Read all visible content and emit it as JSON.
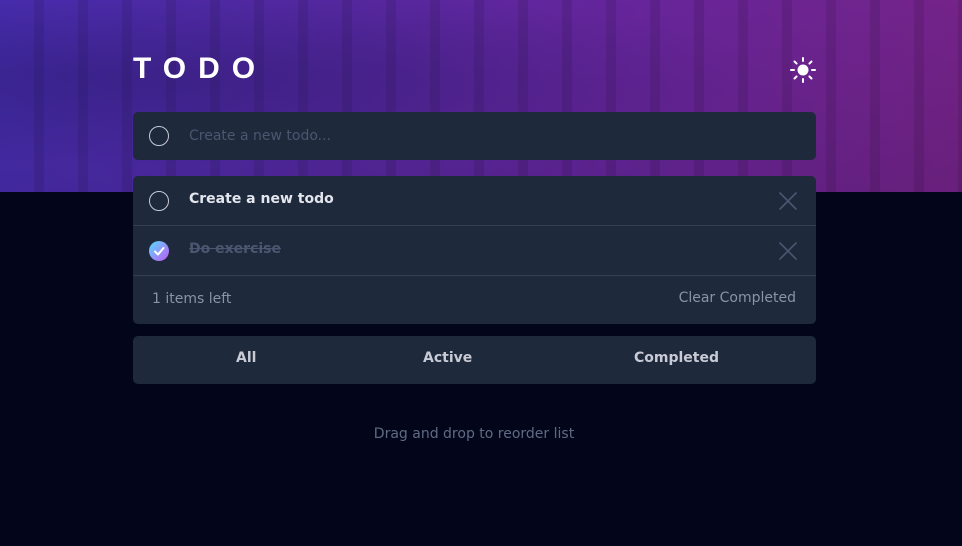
{
  "header": {
    "title": "TODO",
    "theme_icon": "sun-icon"
  },
  "new_todo": {
    "placeholder": "Create a new todo...",
    "value": ""
  },
  "todos": [
    {
      "label": "Create a new todo",
      "completed": false
    },
    {
      "label": "Do exercise",
      "completed": true
    }
  ],
  "footer": {
    "items_left": "1 items left",
    "clear_label": "Clear Completed"
  },
  "filters": {
    "all": "All",
    "active": "Active",
    "completed": "Completed"
  },
  "hint": "Drag and drop to reorder list",
  "colors": {
    "accent_start": "#57ddff",
    "accent_end": "#c058f3",
    "card": "#1e293b",
    "background": "#03061a"
  }
}
